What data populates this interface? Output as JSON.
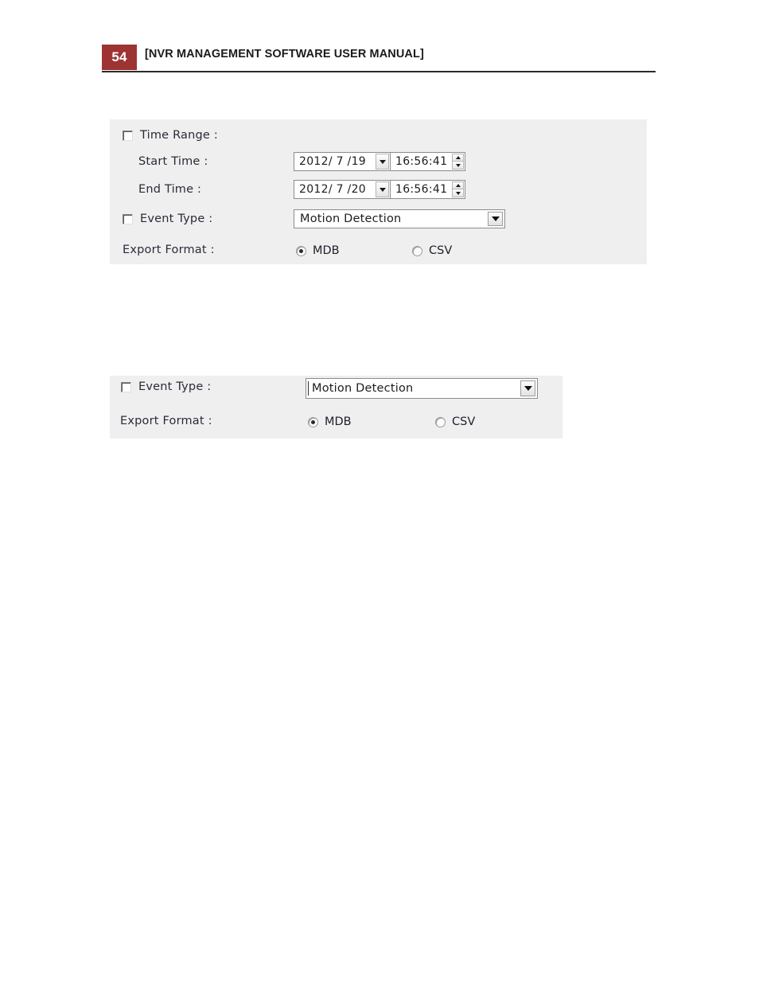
{
  "header": {
    "page_number": "54",
    "title": "[NVR MANAGEMENT SOFTWARE USER MANUAL]",
    "badge_color": "#9d3333",
    "rule_color": "#2b2b2b"
  },
  "panel_time_range": {
    "time_range": {
      "label": "Time Range :",
      "checked": false
    },
    "start_time": {
      "label": "Start Time :",
      "date_value": "2012/ 7 /19",
      "time_value": "16:56:41"
    },
    "end_time": {
      "label": "End Time :",
      "date_value": "2012/ 7 /20",
      "time_value": "16:56:41"
    },
    "event_type": {
      "label": "Event Type :",
      "checked": false,
      "selected_option": "Motion Detection"
    },
    "export_format": {
      "label": "Export Format :",
      "options": [
        {
          "label": "MDB",
          "selected": true
        },
        {
          "label": "CSV",
          "selected": false
        }
      ]
    }
  },
  "panel_event_type": {
    "event_type": {
      "label": "Event Type :",
      "checked": false,
      "selected_option": "Motion Detection"
    },
    "export_format": {
      "label": "Export Format :",
      "options": [
        {
          "label": "MDB",
          "selected": true
        },
        {
          "label": "CSV",
          "selected": false
        }
      ]
    }
  },
  "colors": {
    "panel_background": "#efefef",
    "page_background": "#ffffff",
    "field_background": "#ffffff",
    "field_border": "#8c8c8c",
    "text": "#2b2b3a"
  }
}
